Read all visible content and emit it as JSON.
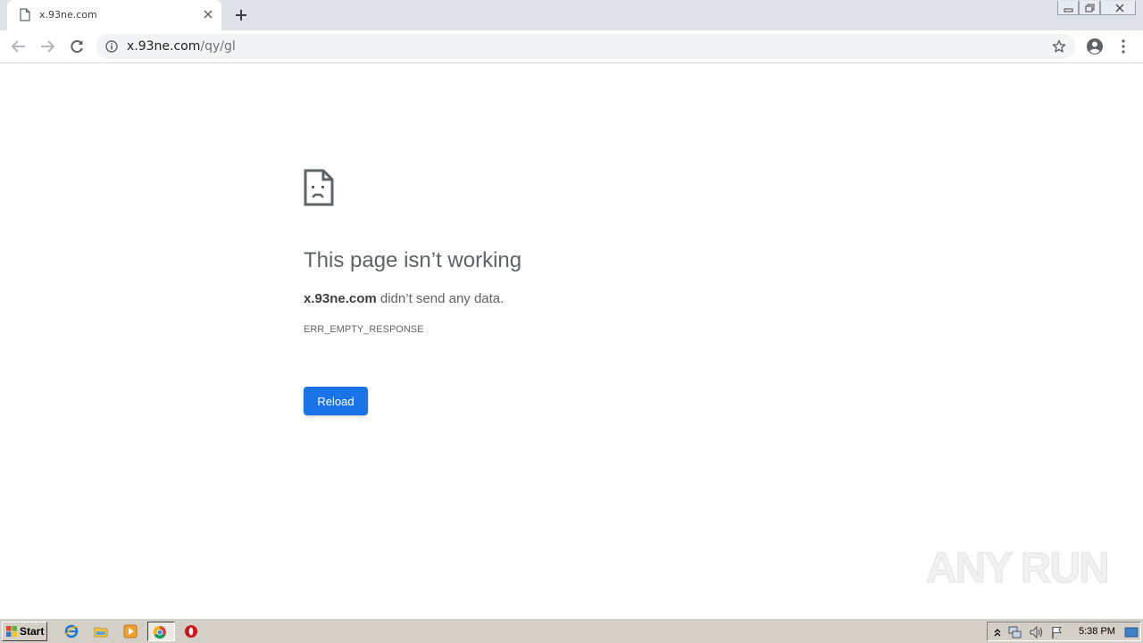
{
  "browser": {
    "tab": {
      "title": "x.93ne.com"
    },
    "address_bar": {
      "host": "x.93ne.com",
      "path": "/qy/gl"
    }
  },
  "error_page": {
    "title": "This page isn’t working",
    "host": "x.93ne.com",
    "description_suffix": " didn’t send any data.",
    "error_code": "ERR_EMPTY_RESPONSE",
    "reload_label": "Reload"
  },
  "watermark": {
    "text": "ANY RUN"
  },
  "taskbar": {
    "start_label": "Start",
    "clock": "5:38 PM",
    "apps": [
      "internet-explorer-icon",
      "file-explorer-icon",
      "media-player-icon",
      "chrome-icon",
      "opera-icon"
    ]
  },
  "colors": {
    "accent": "#1a73e8",
    "tabstrip": "#dee1e6",
    "omnibox": "#f1f3f4",
    "taskbar": "#d4d0c8"
  }
}
